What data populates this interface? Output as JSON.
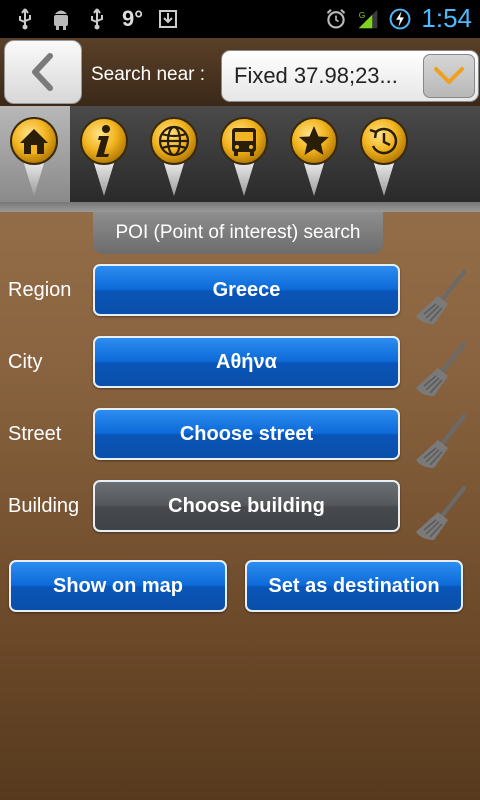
{
  "status_bar": {
    "temperature": "9°",
    "time": "1:54",
    "icons": [
      "usb-icon",
      "android-debug-icon",
      "usb-icon",
      "download-icon",
      "alarm-icon",
      "signal-icon",
      "battery-charging-icon"
    ]
  },
  "header": {
    "search_label": "Search near :",
    "search_value": "Fixed 37.98;23...",
    "back_icon": "chevron-left-icon",
    "dropdown_icon": "chevron-down-icon",
    "accent_color": "#f0a020"
  },
  "toolbar": {
    "items": [
      {
        "icon": "home-icon",
        "selected": true
      },
      {
        "icon": "info-icon",
        "selected": false
      },
      {
        "icon": "globe-icon",
        "selected": false
      },
      {
        "icon": "bus-icon",
        "selected": false
      },
      {
        "icon": "star-icon",
        "selected": false
      },
      {
        "icon": "history-icon",
        "selected": false
      }
    ]
  },
  "section_title": "POI (Point of interest) search",
  "fields": [
    {
      "label": "Region",
      "value": "Greece"
    },
    {
      "label": "City",
      "value": "Αθήνα"
    },
    {
      "label": "Street",
      "value": "Choose street"
    },
    {
      "label": "Building",
      "value": "Choose building"
    }
  ],
  "actions": {
    "show_on_map": "Show on map",
    "set_destination": "Set as destination"
  }
}
